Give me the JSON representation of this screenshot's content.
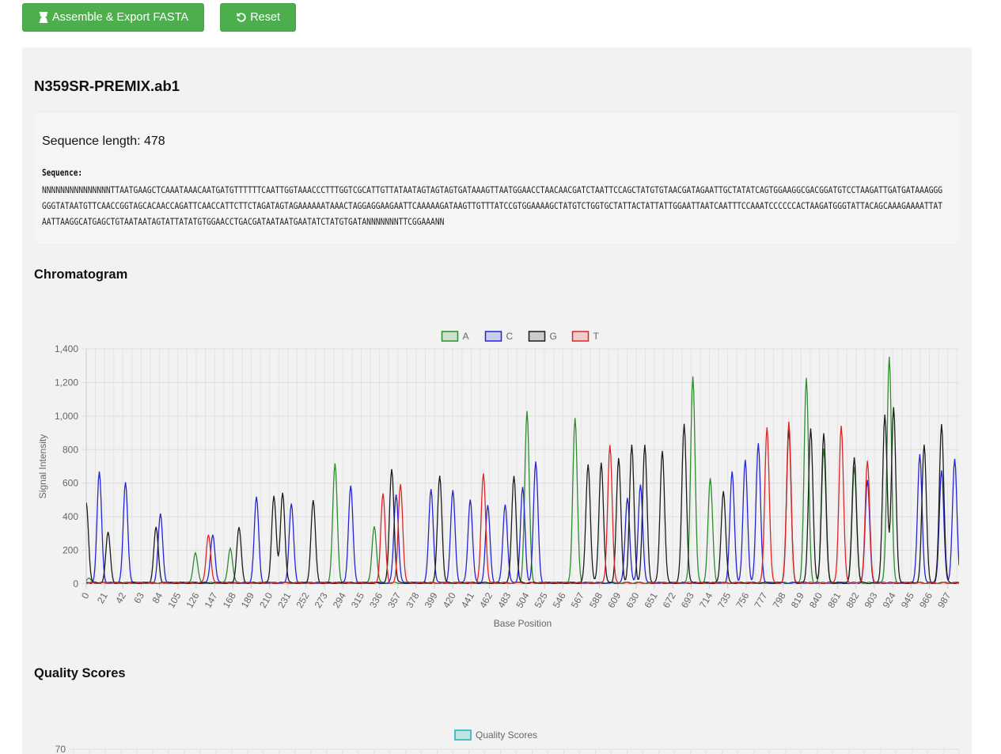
{
  "toolbar": {
    "assemble_label": "Assemble & Export FASTA",
    "reset_label": "Reset"
  },
  "file": {
    "name": "N359SR-PREMIX.ab1",
    "sequence_length_text": "Sequence length: 478",
    "sequence_label": "Sequence:",
    "sequence": "NNNNNNNNNNNNNNNTTAATGAAGCTCAAATAAACAATGATGTTTTTTCAATTGGTAAACCCTTTGGTCGCATTGTTATAATAGTAGTAGTGATAAAGTTAATGGAACCTAACAACGATCTAATTCCAGCTATGTGTAACGATAGAATTGCTATATCAGTGGAAGGCGACGGATGTCCTAAGATTGATGATAAAGGGGGGTATAATGTTCAACCGGTAGCACAACCAGATTCAACCATTCTTCTAGATAGTAGAAAAAATAAACTAGGAGGAAGAATTCAAAAAGATAAGTTGTTTATCCGTGGAAAAGCTATGTCTGGTGCTATTACTATTATTGGAATTAATCAATTTCCAAATCCCCCCACTAAGATGGGTATTACAGCAAAGAAAATTATAATTAAGGCATGAGCTGTAATAATAGTATTATATGTGGAACCTGACGATAATAATGAATATCTATGTGATANNNNNNNTTCGGAAANN"
  },
  "chromatogram": {
    "title": "Chromatogram",
    "chart_data": {
      "type": "line",
      "xlabel": "Base Position",
      "ylabel": "Signal Intensity",
      "ylim": [
        0,
        1400
      ],
      "yticks": [
        0,
        200,
        400,
        600,
        800,
        1000,
        1200,
        1400
      ],
      "xlim": [
        0,
        1000
      ],
      "xtick_step": 21,
      "grid": true,
      "legend_position": "top-center",
      "series": [
        {
          "name": "A",
          "color": "#2e8b2e",
          "peaks": [
            [
              3,
              25
            ],
            [
              125,
              180
            ],
            [
              165,
              210
            ],
            [
              285,
              710
            ],
            [
              330,
              340
            ],
            [
              505,
              1020
            ],
            [
              560,
              980
            ],
            [
              695,
              1235
            ],
            [
              715,
              620
            ],
            [
              825,
              1220
            ],
            [
              845,
              800
            ],
            [
              880,
              690
            ],
            [
              920,
              1350
            ]
          ]
        },
        {
          "name": "C",
          "color": "#2424d6",
          "peaks": [
            [
              15,
              660
            ],
            [
              45,
              600
            ],
            [
              85,
              410
            ],
            [
              145,
              290
            ],
            [
              195,
              510
            ],
            [
              235,
              470
            ],
            [
              303,
              580
            ],
            [
              355,
              530
            ],
            [
              395,
              560
            ],
            [
              420,
              550
            ],
            [
              440,
              500
            ],
            [
              460,
              460
            ],
            [
              480,
              470
            ],
            [
              500,
              570
            ],
            [
              515,
              720
            ],
            [
              620,
              510
            ],
            [
              635,
              590
            ],
            [
              740,
              660
            ],
            [
              755,
              730
            ],
            [
              770,
              830
            ],
            [
              895,
              610
            ],
            [
              955,
              770
            ],
            [
              980,
              670
            ],
            [
              995,
              740
            ]
          ]
        },
        {
          "name": "G",
          "color": "#1c1c1c",
          "peaks": [
            [
              0,
              480
            ],
            [
              25,
              300
            ],
            [
              80,
              330
            ],
            [
              175,
              330
            ],
            [
              215,
              520
            ],
            [
              225,
              540
            ],
            [
              260,
              490
            ],
            [
              350,
              680
            ],
            [
              405,
              640
            ],
            [
              490,
              640
            ],
            [
              575,
              710
            ],
            [
              590,
              720
            ],
            [
              610,
              740
            ],
            [
              625,
              820
            ],
            [
              640,
              820
            ],
            [
              660,
              790
            ],
            [
              685,
              950
            ],
            [
              730,
              550
            ],
            [
              805,
              910
            ],
            [
              830,
              920
            ],
            [
              845,
              890
            ],
            [
              880,
              750
            ],
            [
              915,
              1000
            ],
            [
              925,
              1050
            ],
            [
              960,
              820
            ],
            [
              980,
              950
            ]
          ]
        },
        {
          "name": "T",
          "color": "#e02424",
          "peaks": [
            [
              140,
              290
            ],
            [
              340,
              530
            ],
            [
              360,
              590
            ],
            [
              455,
              650
            ],
            [
              600,
              825
            ],
            [
              780,
              930
            ],
            [
              805,
              960
            ],
            [
              865,
              940
            ],
            [
              895,
              730
            ]
          ]
        }
      ]
    }
  },
  "quality": {
    "title": "Quality Scores",
    "chart_data": {
      "type": "bar",
      "legend": "Quality Scores",
      "legend_color": "#4bc0c0",
      "ylim": [
        0,
        70
      ],
      "yticks": [
        70
      ]
    }
  }
}
